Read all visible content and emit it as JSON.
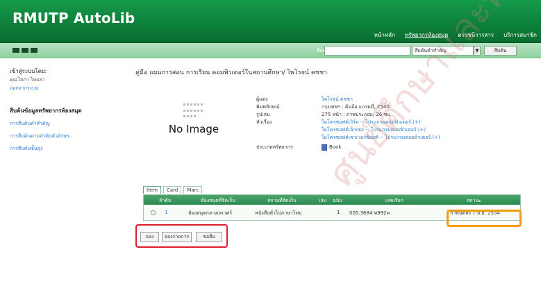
{
  "header": {
    "brand": "RMUTP AutoLib",
    "nav": [
      {
        "label": "หน้าหลัก",
        "active": false
      },
      {
        "label": "ทรัพยากรห้องสมุด",
        "active": true
      },
      {
        "label": "ดรรชนีวารสาร",
        "active": false
      },
      {
        "label": "บริการสมาชิก",
        "active": false
      }
    ]
  },
  "search": {
    "label": "สืบค้น:",
    "input_value": "",
    "select_value": "สืบค้นคำสำคัญ",
    "button_label": "สืบค้น"
  },
  "sidebar": {
    "login_heading": "เข้าสู่ระบบโดย:",
    "user_name": "คุณโสภา ไทยลา",
    "logout": "ออกจากระบบ",
    "section_title": "สืบค้นข้อมูลทรัพยากรห้องสมุด",
    "links": [
      "การสืบค้นคำสำคัญ",
      "การสืบค้นตามลำดับตัวอักษร",
      "การสืบค้นขั้นสูง"
    ]
  },
  "record": {
    "title": "คู่มือ แผนการสอน การเรียน คอมพิวเตอร์ในสถานศึกษา/ ไพโรจน์ คชชา",
    "no_image": "No Image",
    "fields": [
      {
        "key": "ผู้แต่ง",
        "value": "ไพโรจน์ คชชา",
        "link": true
      },
      {
        "key": "พิมพลักษณ์",
        "value": "กรุงเทพฯ : ต้นอ้อ แกรมมี่, 2540",
        "link": false
      },
      {
        "key": "รูปเล่ม",
        "value": "275 หน้า : ภาพประกอบ; 26 ซม",
        "link": false
      },
      {
        "key": "หัวเรื่อง",
        "value": "ไมโครซอฟต์เวิร์ด -- โปรแกรมคอมพิวเตอร์.(+)",
        "link": true
      },
      {
        "key": "",
        "value": "ไมโครซอฟต์เอ็กเซล -- โปรแกรมคอมพิวเตอร์.(+)",
        "link": true
      },
      {
        "key": "",
        "value": "ไมโครซอฟต์เพาเวอร์พ้อยท์ -- โปรแกรมคอมพิวเตอร์.(+)",
        "link": true
      },
      {
        "key": "ประเภททรัพยากร",
        "value": "Book",
        "link": false
      }
    ]
  },
  "tabs": [
    "Item",
    "Card",
    "Marc"
  ],
  "items_table": {
    "headers": [
      "ลำดับ",
      "ห้องสมุดที่จัดเก็บ",
      "สถานที่จัดเก็บ",
      "เล่ม",
      "ฉบับ",
      "เลขเรียก",
      "สถานะ"
    ],
    "rows": [
      [
        "1",
        "ห้องสมุดกลางเทเวศร์",
        "หนังสือทั่วไปภาษาไทย",
        "",
        "1",
        "005.3684 พ992ค",
        "กำหนดส่ง 7 มิ.ย. 2554"
      ]
    ]
  },
  "actions": {
    "reserve": "จอง",
    "reserve_list": "จองรายการ",
    "borrow": "ขอยืม"
  },
  "watermark": "ศูนย์ศึกษาและพัฒนา"
}
